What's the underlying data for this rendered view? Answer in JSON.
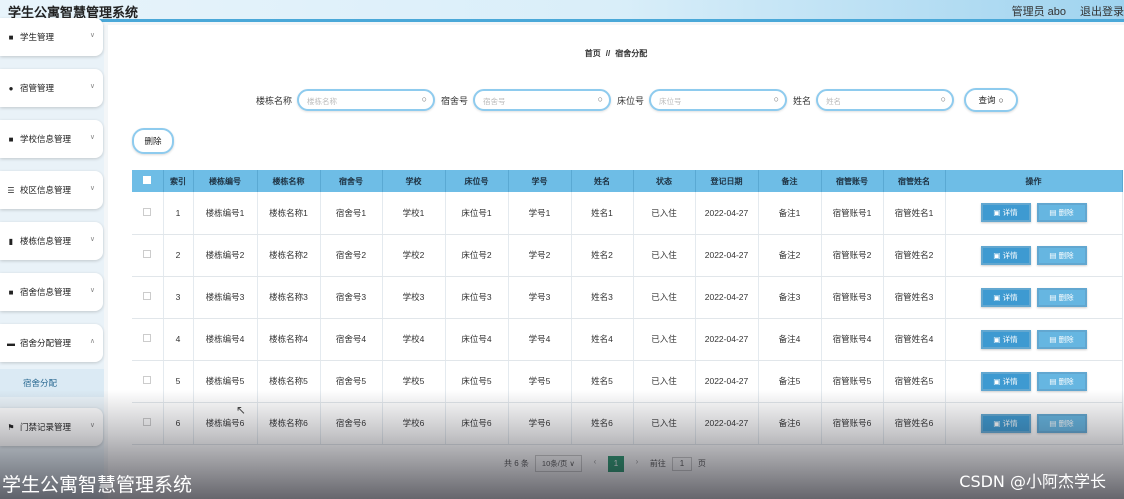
{
  "header": {
    "title": "学生公寓智慧管理系统",
    "user": "管理员 abo",
    "logout": "退出登录"
  },
  "sidebar": {
    "items": [
      {
        "label": "学生管理",
        "icon": "grid-icon"
      },
      {
        "label": "宿管管理",
        "icon": "user-icon"
      },
      {
        "label": "学校信息管理",
        "icon": "grid-icon"
      },
      {
        "label": "校区信息管理",
        "icon": "sliders-icon"
      },
      {
        "label": "楼栋信息管理",
        "icon": "bar-icon"
      },
      {
        "label": "宿舍信息管理",
        "icon": "grid-icon"
      },
      {
        "label": "宿舍分配管理",
        "icon": "card-icon"
      },
      {
        "label": "门禁记录管理",
        "icon": "flag-icon"
      }
    ],
    "active_sub": "宿舍分配"
  },
  "breadcrumb": {
    "home": "首页",
    "sep": "//",
    "current": "宿舍分配"
  },
  "search": {
    "fields": [
      {
        "label": "楼栋名称",
        "placeholder": "楼栋名称"
      },
      {
        "label": "宿舍号",
        "placeholder": "宿舍号"
      },
      {
        "label": "床位号",
        "placeholder": "床位号"
      },
      {
        "label": "姓名",
        "placeholder": "姓名"
      }
    ],
    "button": "查询"
  },
  "toolbar": {
    "delete": "删除"
  },
  "table": {
    "headers": [
      "索引",
      "楼栋编号",
      "楼栋名称",
      "宿舍号",
      "学校",
      "床位号",
      "学号",
      "姓名",
      "状态",
      "登记日期",
      "备注",
      "宿管账号",
      "宿管姓名",
      "操作"
    ],
    "rows": [
      [
        "1",
        "楼栋编号1",
        "楼栋名称1",
        "宿舍号1",
        "学校1",
        "床位号1",
        "学号1",
        "姓名1",
        "已入住",
        "2022-04-27",
        "备注1",
        "宿管账号1",
        "宿管姓名1"
      ],
      [
        "2",
        "楼栋编号2",
        "楼栋名称2",
        "宿舍号2",
        "学校2",
        "床位号2",
        "学号2",
        "姓名2",
        "已入住",
        "2022-04-27",
        "备注2",
        "宿管账号2",
        "宿管姓名2"
      ],
      [
        "3",
        "楼栋编号3",
        "楼栋名称3",
        "宿舍号3",
        "学校3",
        "床位号3",
        "学号3",
        "姓名3",
        "已入住",
        "2022-04-27",
        "备注3",
        "宿管账号3",
        "宿管姓名3"
      ],
      [
        "4",
        "楼栋编号4",
        "楼栋名称4",
        "宿舍号4",
        "学校4",
        "床位号4",
        "学号4",
        "姓名4",
        "已入住",
        "2022-04-27",
        "备注4",
        "宿管账号4",
        "宿管姓名4"
      ],
      [
        "5",
        "楼栋编号5",
        "楼栋名称5",
        "宿舍号5",
        "学校5",
        "床位号5",
        "学号5",
        "姓名5",
        "已入住",
        "2022-04-27",
        "备注5",
        "宿管账号5",
        "宿管姓名5"
      ],
      [
        "6",
        "楼栋编号6",
        "楼栋名称6",
        "宿舍号6",
        "学校6",
        "床位号6",
        "学号6",
        "姓名6",
        "已入住",
        "2022-04-27",
        "备注6",
        "宿管账号6",
        "宿管姓名6"
      ]
    ],
    "detail_label": "详情",
    "delete_label": "删除"
  },
  "pagination": {
    "total": "共 6 条",
    "page_size": "10条/页",
    "prev": "‹",
    "current": "1",
    "next": "›",
    "goto_prefix": "前往",
    "goto_value": "1",
    "goto_suffix": "页"
  },
  "watermark": {
    "left": "学生公寓智慧管理系统",
    "right": "CSDN @小阿杰学长"
  },
  "colors": {
    "accent": "#6ebde6",
    "button": "#3e9ad1",
    "page_active": "#2e9a72"
  }
}
